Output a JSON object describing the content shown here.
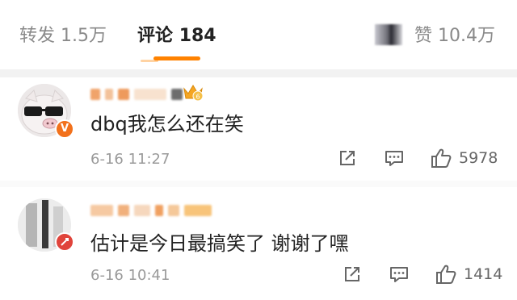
{
  "tabs": {
    "reposts": {
      "label": "转发",
      "count": "1.5万"
    },
    "comments": {
      "label": "评论",
      "count": "184"
    },
    "likes": {
      "label": "赞",
      "count": "10.4万"
    }
  },
  "accent_color": "#ff8200",
  "comments": [
    {
      "text": "dbq我怎么还在笑",
      "time": "6-16 11:27",
      "like_count": "5978",
      "badge": "V",
      "badge_color": "#f2711c"
    },
    {
      "text": "估计是今日最搞笑了 谢谢了嘿",
      "time": "6-16 10:41",
      "like_count": "1414",
      "badge_color": "#e0443b"
    }
  ]
}
